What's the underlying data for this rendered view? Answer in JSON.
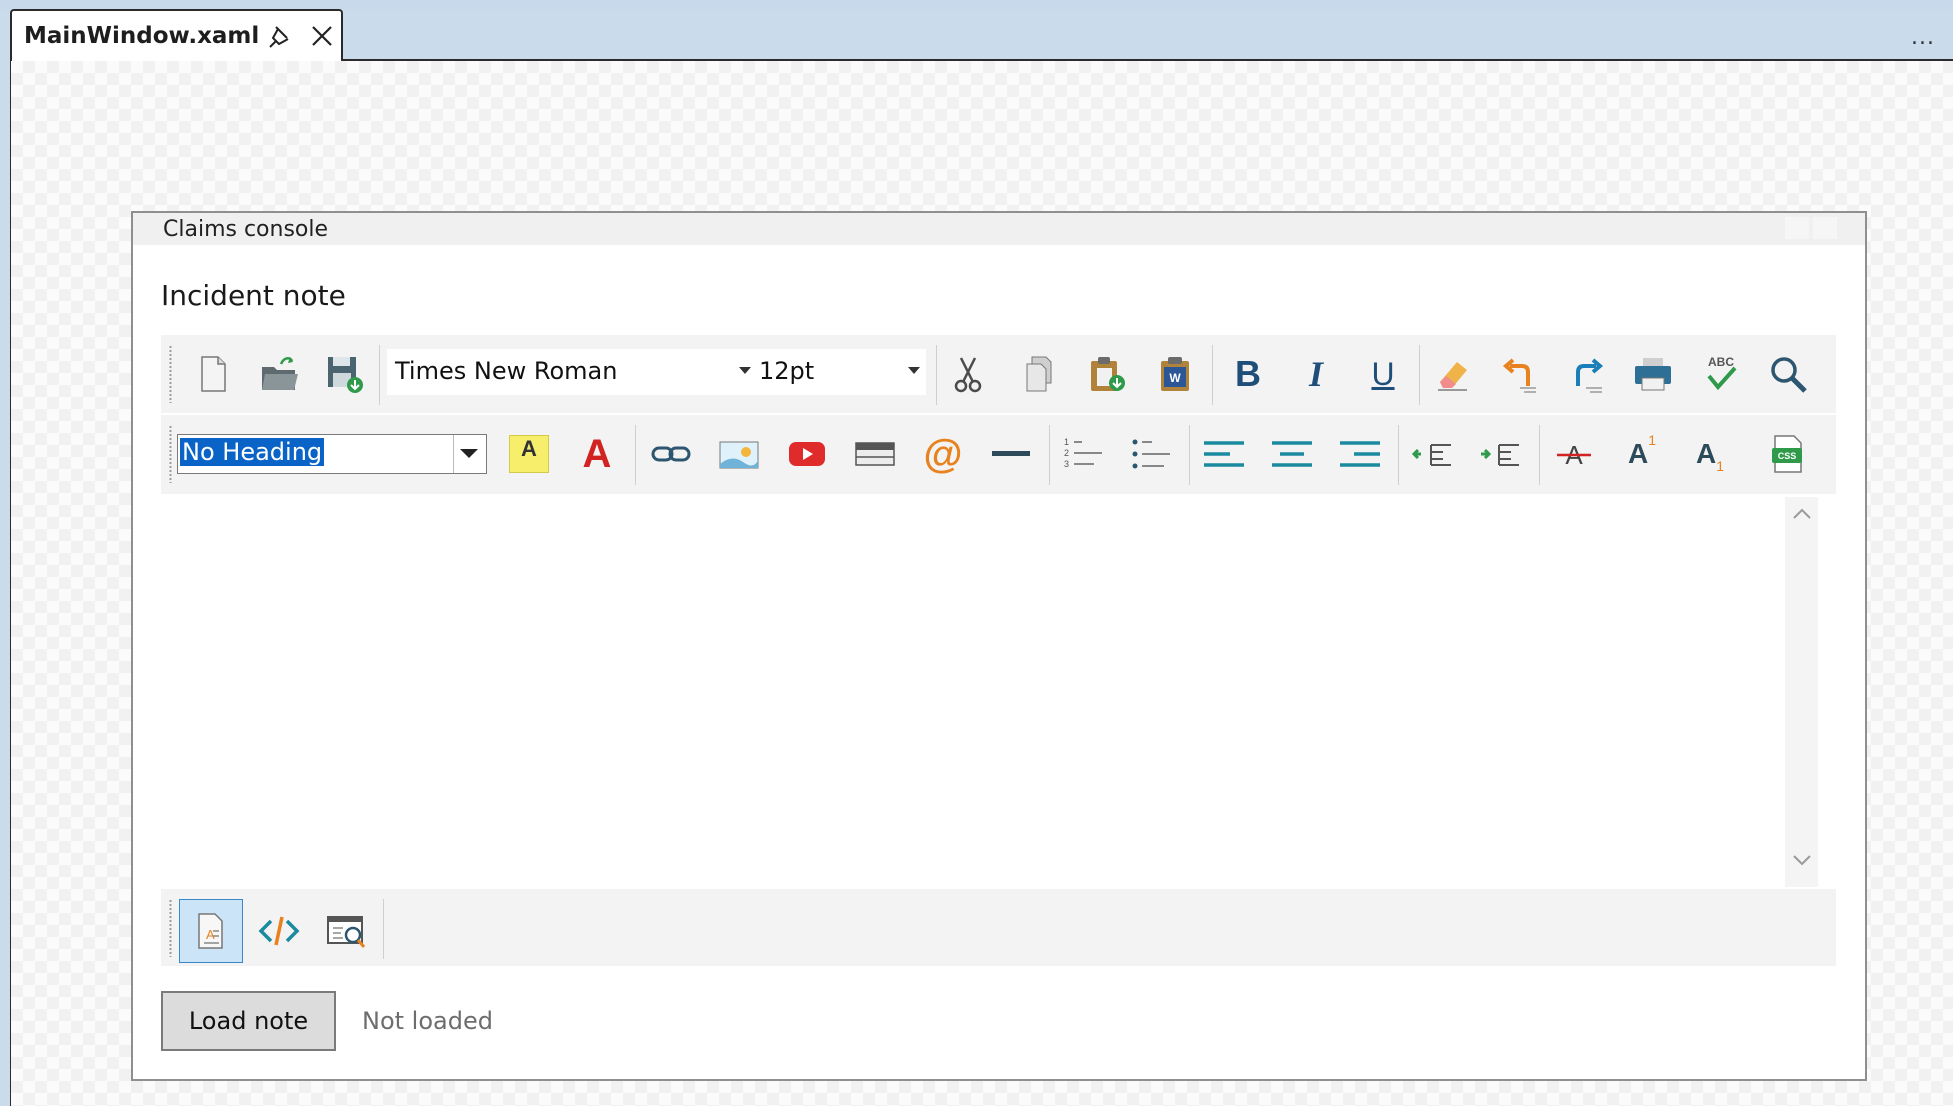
{
  "ide": {
    "tab_title": "MainWindow.xaml",
    "pin_icon": "pin-icon",
    "close_icon": "close-icon",
    "overflow": "..."
  },
  "window": {
    "title": "Claims console",
    "editor_label": "Incident note"
  },
  "toolbar1": {
    "font_family": "Times New Roman",
    "font_size": "12pt",
    "icons": [
      "new-document-icon",
      "open-folder-icon",
      "save-icon",
      "cut-icon",
      "copy-icon",
      "paste-icon",
      "paste-from-word-icon",
      "bold-icon",
      "italic-icon",
      "underline-icon",
      "clear-formatting-icon",
      "undo-icon",
      "redo-icon",
      "print-icon",
      "spellcheck-icon",
      "find-icon"
    ],
    "labels": {
      "bold": "B",
      "italic": "I",
      "underline": "U",
      "spellcheck": "ABC"
    }
  },
  "toolbar2": {
    "heading": "No Heading",
    "icons": [
      "highlight-icon",
      "font-color-icon",
      "hyperlink-icon",
      "image-icon",
      "youtube-icon",
      "table-icon",
      "email-link-icon",
      "horizontal-rule-icon",
      "numbered-list-icon",
      "bulleted-list-icon",
      "align-left-icon",
      "align-center-icon",
      "align-right-icon",
      "outdent-icon",
      "indent-icon",
      "strikethrough-icon",
      "superscript-icon",
      "subscript-icon",
      "css-icon"
    ],
    "labels": {
      "highlight": "A",
      "font_color": "A",
      "email": "@",
      "superscript": "A",
      "sup": "1",
      "subscript": "A",
      "sub": "1",
      "css": "CSS"
    }
  },
  "viewbar": {
    "icons": [
      "design-view-icon",
      "html-source-view-icon",
      "preview-icon"
    ]
  },
  "footer": {
    "load_button": "Load note",
    "status": "Not loaded"
  },
  "colors": {
    "accent": "#1f6fb5",
    "teal": "#1a8a9e",
    "red": "#d32222",
    "orange": "#e8821e",
    "selection": "#0a64c8"
  }
}
